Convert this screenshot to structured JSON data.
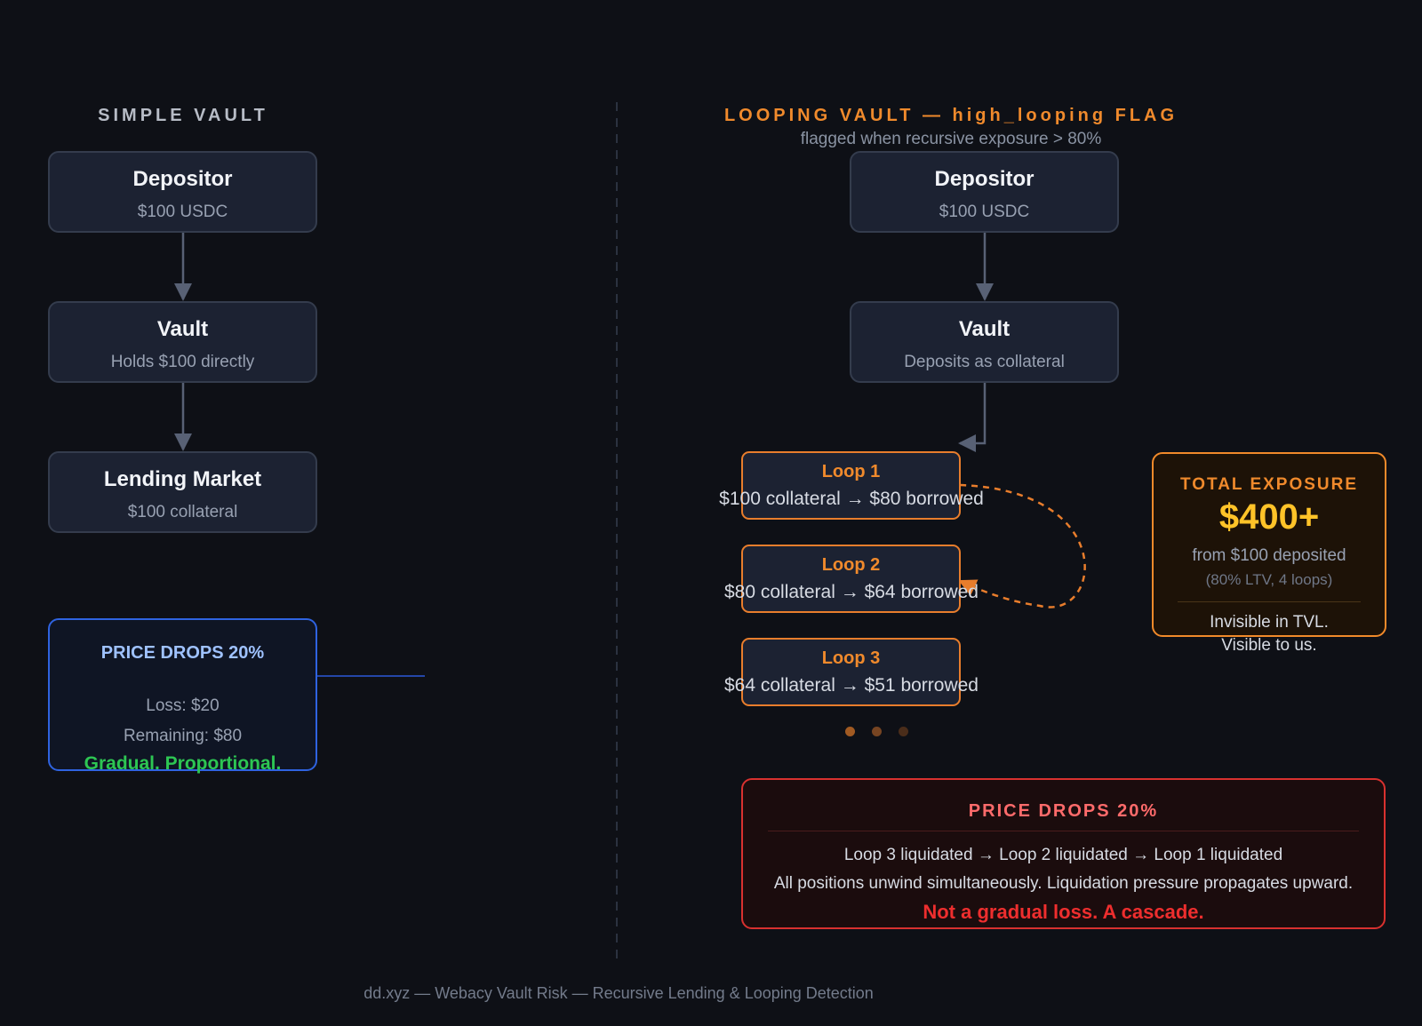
{
  "left": {
    "heading": "SIMPLE VAULT",
    "nodes": [
      {
        "title": "Depositor",
        "sub": "$100 USDC"
      },
      {
        "title": "Vault",
        "sub": "Holds $100 directly"
      },
      {
        "title": "Lending Market",
        "sub": "$100 collateral"
      }
    ],
    "drop": {
      "title": "PRICE DROPS 20%",
      "loss": "Loss: $20",
      "remaining": "Remaining: $80",
      "verdict": "Gradual. Proportional."
    }
  },
  "right": {
    "heading": "LOOPING VAULT — high_looping FLAG",
    "subheading": "flagged when recursive exposure > 80%",
    "nodes": [
      {
        "title": "Depositor",
        "sub": "$100 USDC"
      },
      {
        "title": "Vault",
        "sub": "Deposits as collateral"
      }
    ],
    "loops": [
      {
        "title": "Loop 1",
        "detail": "$100 collateral → $80 borrowed"
      },
      {
        "title": "Loop 2",
        "detail": "$80 collateral → $64 borrowed"
      },
      {
        "title": "Loop 3",
        "detail": "$64 collateral → $51 borrowed"
      }
    ],
    "exposure": {
      "title": "TOTAL EXPOSURE",
      "value": "$400+",
      "from": "from $100 deposited",
      "params": "(80% LTV, 4 loops)",
      "note_line1": "Invisible in TVL.",
      "note_line2": "Visible to us."
    },
    "drop": {
      "title": "PRICE DROPS 20%",
      "line1": "Loop 3 liquidated → Loop 2 liquidated → Loop 1 liquidated",
      "line2": "All positions unwind simultaneously. Liquidation pressure propagates upward.",
      "verdict": "Not a gradual loss. A cascade."
    }
  },
  "footer": "dd.xyz — Webacy Vault Risk — Recursive Lending & Looping Detection",
  "colors": {
    "background": "#0e1016",
    "node_fill": "#1c2232",
    "node_border": "#343c4d",
    "loop_orange": "#f08a2c",
    "exposure_gold": "#ffc328",
    "blue_border": "#2f63e0",
    "blue_text": "#9fc2ff",
    "green_text": "#2dc653",
    "red_border": "#d8312f",
    "red_text": "#ff6b6b",
    "red_verdict": "#ee2e2e",
    "connector": "#586175"
  }
}
